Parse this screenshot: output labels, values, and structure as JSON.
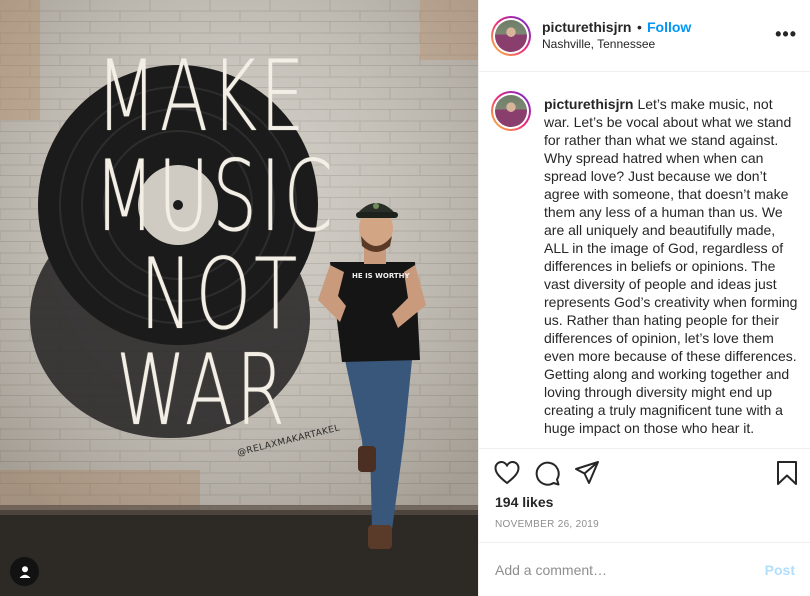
{
  "photo": {
    "mural_words": [
      "MAKE",
      "MUSIC",
      "NOT",
      "WAR"
    ],
    "mural_tag": "@RELAXMAKARTAKEL",
    "shirt_text": "HE IS WORTHY",
    "user_tag_icon": "user-tag-icon"
  },
  "header": {
    "username": "picturethisjrn",
    "separator": "•",
    "follow_label": "Follow",
    "location": "Nashville, Tennessee",
    "more_icon": "more-options-icon",
    "more_label": "•••"
  },
  "caption": {
    "username": "picturethisjrn",
    "text": "Let’s make music, not war. Let’s be vocal about what we stand for rather than what we stand against. Why spread hatred when when can spread love? Just because we don’t agree with someone, that doesn’t make them any less of a human than us. We are all uniquely and beautifully made, ALL in the image of God, regardless of differences in beliefs or opinions. The vast diversity of people and ideas just represents God’s creativity when forming us. Rather than hating people for their differences of opinion, let’s love them even more because of these differences. Getting along and working together and loving through diversity might end up creating a truly magnificent tune with a huge impact on those who hear it."
  },
  "actions": {
    "icons": [
      "heart-icon",
      "comment-icon",
      "share-icon",
      "bookmark-icon"
    ],
    "likes": "194 likes",
    "date": "NOVEMBER 26, 2019"
  },
  "comment": {
    "placeholder": "Add a comment…",
    "post_label": "Post",
    "post_color": "#b2dffc"
  },
  "colors": {
    "link_blue": "#0095f6",
    "meta_gray": "#8e8e8e",
    "text": "#262626"
  }
}
